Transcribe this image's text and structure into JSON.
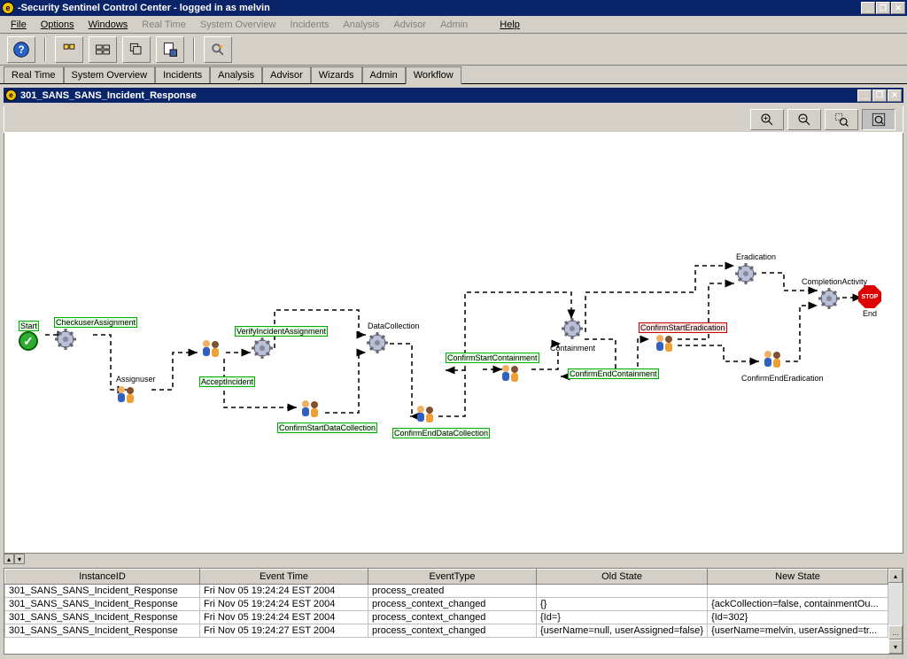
{
  "window": {
    "title": "-Security Sentinel Control Center - logged in as melvin"
  },
  "menu": {
    "file": "File",
    "options": "Options",
    "windows": "Windows",
    "realtime": "Real Time",
    "sysoverview": "System Overview",
    "incidents": "Incidents",
    "analysis": "Analysis",
    "advisor": "Advisor",
    "admin": "Admin",
    "help": "Help"
  },
  "tabs": [
    "Real Time",
    "System Overview",
    "Incidents",
    "Analysis",
    "Advisor",
    "Wizards",
    "Admin",
    "Workflow"
  ],
  "active_tab": "Workflow",
  "inner_window": {
    "title": "301_SANS_SANS_Incident_Response"
  },
  "workflow_nodes": {
    "start": "Start",
    "checkUserAssignment": "CheckuserAssignment",
    "assignUser": "Assignuser",
    "acceptIncident": "AcceptIncident",
    "verifyIncidentAssignment": "VerifyIncidentAssignment",
    "confirmStartDataCollection": "ConfirmStartDataCollection",
    "dataCollection": "DataCollection",
    "confirmEndDataCollection": "ConfirmEndDataCollection",
    "confirmStartContainment": "ConfirmStartContainment",
    "containment": "Containment",
    "confirmEndContainment": "ConfirmEndContainment",
    "confirmStartEradication": "ConfirmStartEradication",
    "eradication": "Eradication",
    "confirmEndEradication": "ConfirmEndEradication",
    "completionActivity": "CompletionActivity",
    "end": "End"
  },
  "table": {
    "headers": [
      "InstanceID",
      "Event Time",
      "EventType",
      "Old State",
      "New State"
    ],
    "rows": [
      [
        "301_SANS_SANS_Incident_Response",
        "Fri Nov 05 19:24:24 EST 2004",
        "process_created",
        "",
        ""
      ],
      [
        "301_SANS_SANS_Incident_Response",
        "Fri Nov 05 19:24:24 EST 2004",
        "process_context_changed",
        "{}",
        "{ackCollection=false, containmentOu..."
      ],
      [
        "301_SANS_SANS_Incident_Response",
        "Fri Nov 05 19:24:24 EST 2004",
        "process_context_changed",
        "{Id=}",
        "{Id=302}"
      ],
      [
        "301_SANS_SANS_Incident_Response",
        "Fri Nov 05 19:24:27 EST 2004",
        "process_context_changed",
        "{userName=null, userAssigned=false}",
        "{userName=melvin, userAssigned=tr..."
      ]
    ]
  }
}
